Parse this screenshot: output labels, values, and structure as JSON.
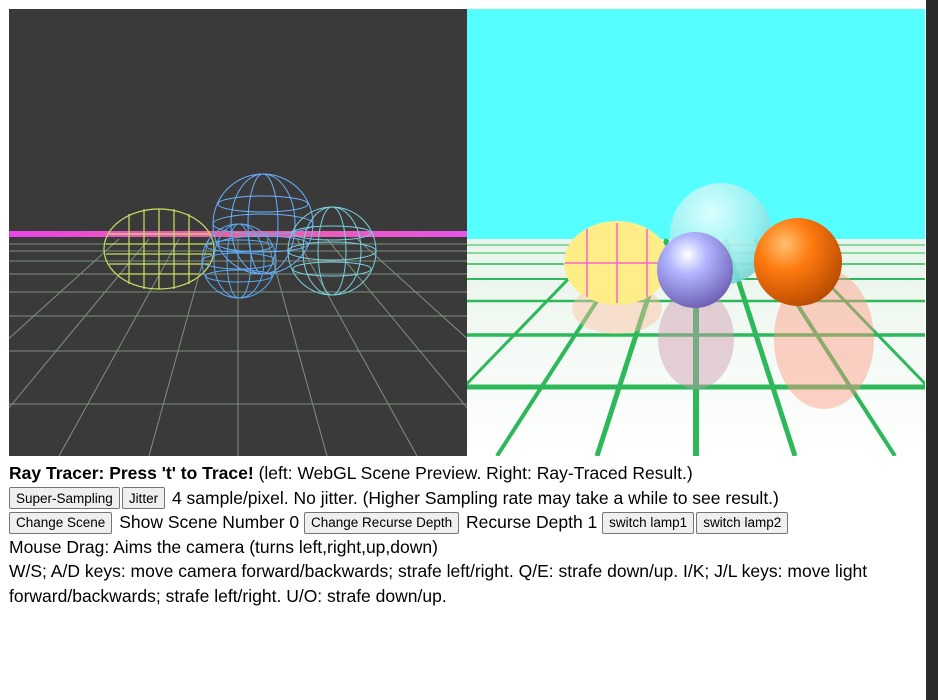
{
  "title_bold": "Ray Tracer: Press 't' to Trace!",
  "title_rest": " (left: WebGL Scene Preview. Right: Ray-Traced Result.)",
  "buttons": {
    "super_sampling": "Super-Sampling",
    "jitter": "Jitter",
    "change_scene": "Change Scene",
    "change_recurse": "Change Recurse Depth",
    "switch_lamp1": "switch lamp1",
    "switch_lamp2": "switch lamp2"
  },
  "sampling_status": " 4 sample/pixel. No jitter. (Higher Sampling rate may take a while to see result.)",
  "scene_status": " Show Scene Number 0 ",
  "recurse_status": " Recurse Depth 1 ",
  "help_mouse": "Mouse Drag: Aims the camera (turns left,right,up,down)",
  "help_keys": "W/S; A/D keys: move camera forward/backwards; strafe left/right. Q/E: strafe down/up. I/K; J/L keys: move light forward/backwards; strafe left/right. U/O: strafe down/up.",
  "colors": {
    "preview_bg": "#3a3a3a",
    "raytrace_sky": "#55ffff",
    "raytrace_grid": "#2db85a",
    "sphere_orange": "#ff7a10",
    "sphere_blue": "#9aa0ff",
    "sphere_cyan": "#a8ffff",
    "disc_yellow": "#ffee88"
  }
}
